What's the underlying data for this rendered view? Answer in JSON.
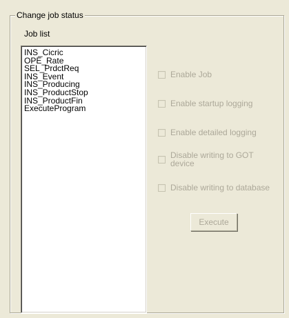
{
  "group": {
    "title": "Change job status"
  },
  "job_list": {
    "label": "Job list",
    "items": [
      "INS_Cicric",
      "OPE_Rate",
      "SEL_PrdctReq",
      "INS_Event",
      "INS_Producing",
      "INS_ProductStop",
      "INS_ProductFin",
      "ExecuteProgram"
    ]
  },
  "options": {
    "enable_job": "Enable Job",
    "enable_startup_logging": "Enable startup logging",
    "enable_detailed_logging": "Enable detailed logging",
    "disable_writing_got": "Disable writing to GOT device",
    "disable_writing_db": "Disable writing to database"
  },
  "execute_button": "Execute",
  "colors": {
    "background": "#ece9d8",
    "disabled_text": "#aca899"
  }
}
